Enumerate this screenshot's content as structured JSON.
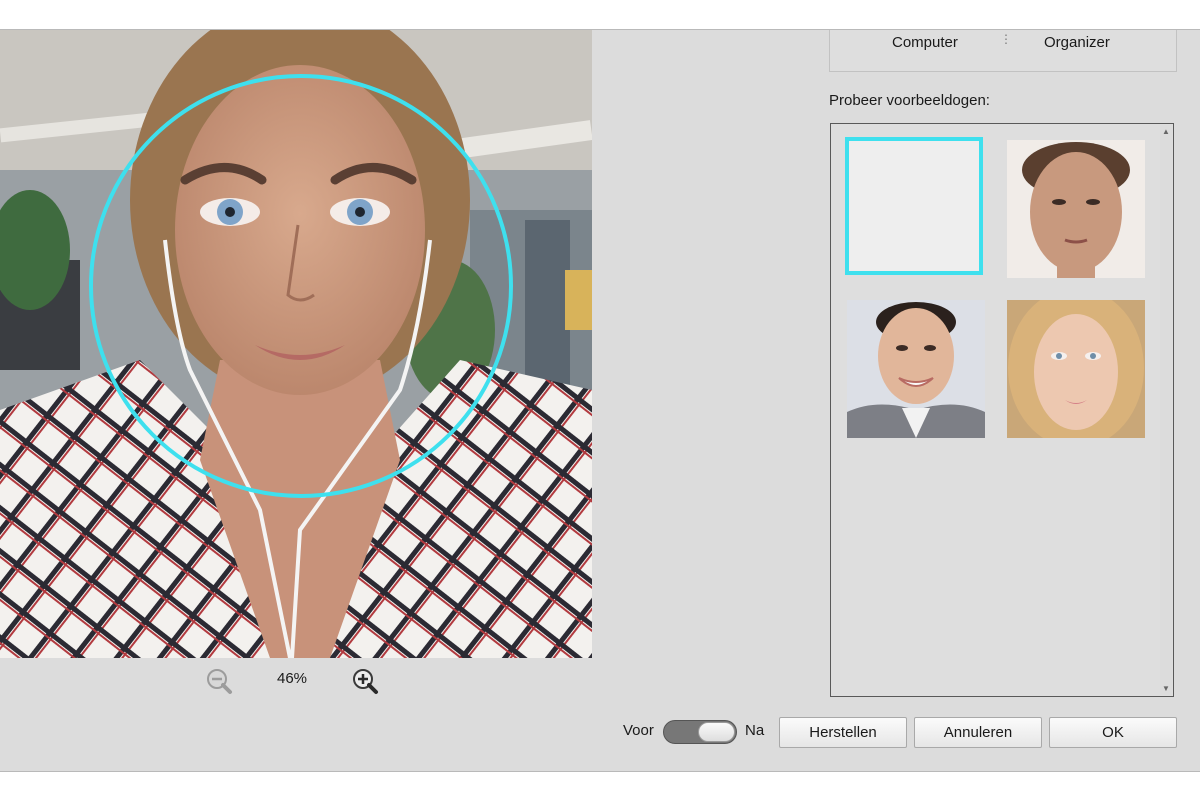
{
  "preview": {
    "zoom_level": "46%",
    "face_circle_color": "#3ee0ee"
  },
  "source_tabs": [
    {
      "label": "Computer"
    },
    {
      "label": "Organizer"
    }
  ],
  "sample_faces": {
    "label": "Probeer voorbeeldogen:",
    "items": [
      {
        "name": "sample-face-woman-1",
        "selected": true
      },
      {
        "name": "sample-face-man-1",
        "selected": false
      },
      {
        "name": "sample-face-man-2",
        "selected": false
      },
      {
        "name": "sample-face-woman-2",
        "selected": false
      }
    ],
    "selection_color": "#3ee0ee"
  },
  "toggle": {
    "left_label": "Voor",
    "right_label": "Na",
    "state": "Na"
  },
  "buttons": {
    "reset": "Herstellen",
    "cancel": "Annuleren",
    "ok": "OK"
  },
  "icons": {
    "zoom_out": "zoom-out-icon",
    "zoom_in": "zoom-in-icon",
    "cursor": "hand-pointer-icon"
  }
}
